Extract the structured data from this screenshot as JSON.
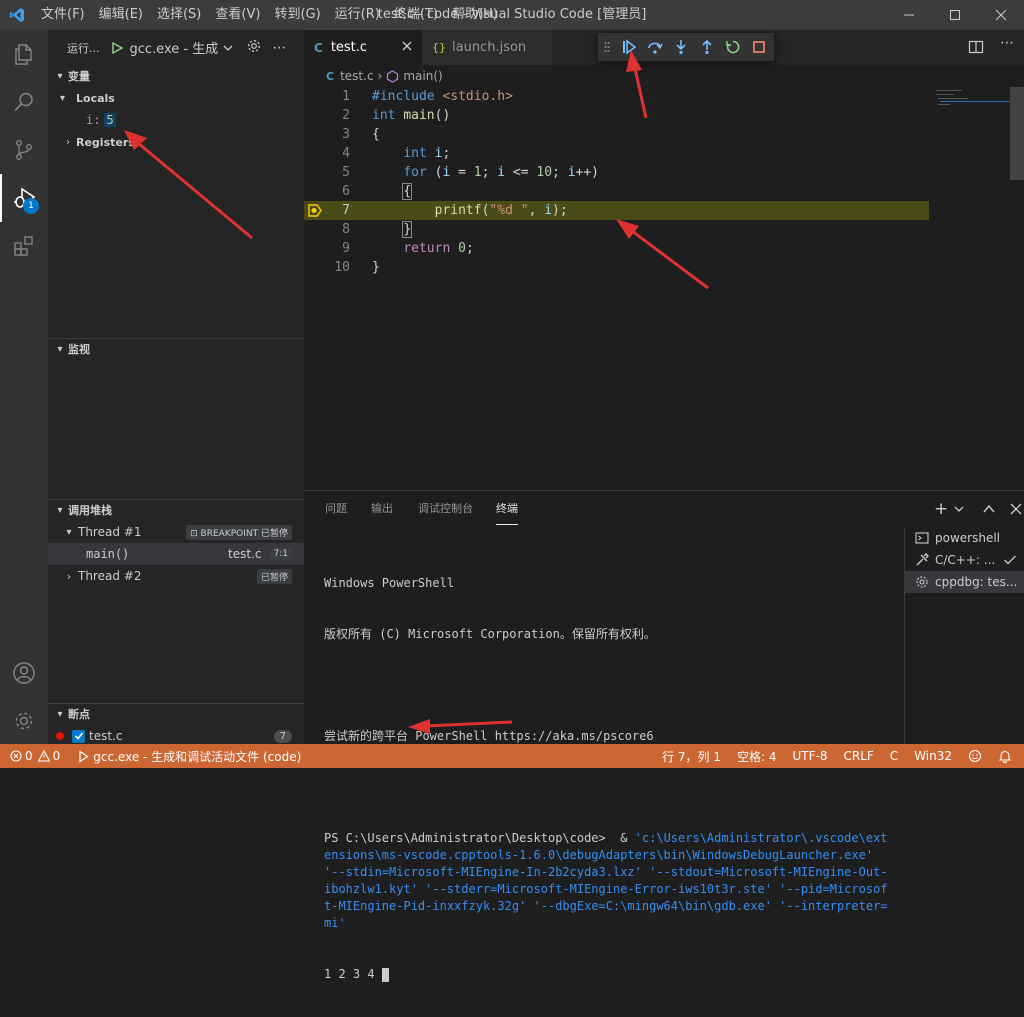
{
  "titlebar": {
    "menus": [
      "文件(F)",
      "编辑(E)",
      "选择(S)",
      "查看(V)",
      "转到(G)",
      "运行(R)",
      "终端(T)",
      "帮助(H)"
    ],
    "title": "test.c - code - Visual Studio Code [管理员]"
  },
  "activity": {
    "debug_badge": "1"
  },
  "sidebar": {
    "run_label": "运行...",
    "config": "gcc.exe - 生成",
    "variables": {
      "title": "变量",
      "locals_label": "Locals",
      "local_var_name": "i:",
      "local_var_value": "5",
      "registers_label": "Registers"
    },
    "watch_title": "监视",
    "callstack": {
      "title": "调用堆栈",
      "thread1": "Thread #1",
      "thread1_status": "⊡ BREAKPOINT 已暂停",
      "frame_fn": "main()",
      "frame_file": "test.c",
      "frame_pos": "7:1",
      "thread2": "Thread #2",
      "thread2_status": "已暂停"
    },
    "breakpoints": {
      "title": "断点",
      "file": "test.c",
      "count": "7"
    }
  },
  "tabs": [
    {
      "label": "test.c",
      "icon": "C"
    },
    {
      "label": "launch.json",
      "icon": "{}"
    }
  ],
  "breadcrumb": {
    "file": "test.c",
    "symbol": "main()"
  },
  "editor": {
    "line_numbers": [
      "1",
      "2",
      "3",
      "4",
      "5",
      "6",
      "7",
      "8",
      "9",
      "10"
    ],
    "current_line": "7"
  },
  "panel": {
    "tabs": [
      "问题",
      "输出",
      "调试控制台",
      "终端"
    ],
    "terminal": {
      "l1": "Windows PowerShell",
      "l2": "版权所有 (C) Microsoft Corporation。保留所有权利。",
      "l3": "尝试新的跨平台 PowerShell https://aka.ms/pscore6",
      "prompt": "PS C:\\Users\\Administrator\\Desktop\\code>  & ",
      "cmd": "'c:\\Users\\Administrator\\.vscode\\extensions\\ms-vscode.cpptools-1.6.0\\debugAdapters\\bin\\WindowsDebugLauncher.exe' '--stdin=Microsoft-MIEngine-In-2b2cyda3.lxz' '--stdout=Microsoft-MIEngine-Out-ibohzlw1.kyt' '--stderr=Microsoft-MIEngine-Error-iws10t3r.ste' '--pid=Microsoft-MIEngine-Pid-inxxfzyk.32g' '--dbgExe=C:\\mingw64\\bin\\gdb.exe' '--interpreter=mi'",
      "output": "1 2 3 4 "
    },
    "terminal_list": [
      "powershell",
      "C/C++: ...",
      "cppdbg: tes..."
    ]
  },
  "statusbar": {
    "errors": "0",
    "warnings": "0",
    "debug": "gcc.exe - 生成和调试活动文件 (code)",
    "position": "行 7，列 1",
    "spaces": "空格: 4",
    "encoding": "UTF-8",
    "eol": "CRLF",
    "language": "C",
    "platform": "Win32"
  },
  "colors": {
    "statusbar": "#cc6633",
    "accent": "#007acc",
    "current_line": "#4b4b18"
  }
}
